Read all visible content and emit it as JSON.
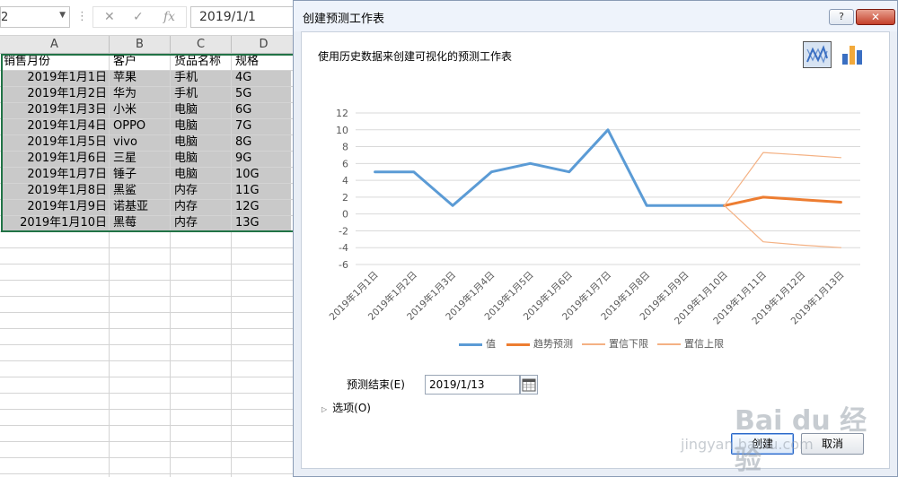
{
  "excel": {
    "namebox": "2",
    "formula_value": "2019/1/1",
    "columns": [
      "A",
      "B",
      "C",
      "D"
    ],
    "headers": [
      "销售月份",
      "客户",
      "货品名称",
      "规格"
    ],
    "rows": [
      [
        "2019年1月1日",
        "苹果",
        "手机",
        "4G"
      ],
      [
        "2019年1月2日",
        "华为",
        "手机",
        "5G"
      ],
      [
        "2019年1月3日",
        "小米",
        "电脑",
        "6G"
      ],
      [
        "2019年1月4日",
        "OPPO",
        "电脑",
        "7G"
      ],
      [
        "2019年1月5日",
        "vivo",
        "电脑",
        "8G"
      ],
      [
        "2019年1月6日",
        "三星",
        "电脑",
        "9G"
      ],
      [
        "2019年1月7日",
        "锤子",
        "电脑",
        "10G"
      ],
      [
        "2019年1月8日",
        "黑鲨",
        "内存",
        "11G"
      ],
      [
        "2019年1月9日",
        "诺基亚",
        "内存",
        "12G"
      ],
      [
        "2019年1月10日",
        "黑莓",
        "内存",
        "13G"
      ]
    ]
  },
  "dialog": {
    "title": "创建预测工作表",
    "help_label": "?",
    "close_label": "✕",
    "subtitle": "使用历史数据来创建可视化的预测工作表",
    "forecast_end_label": "预测结束(E)",
    "forecast_end_value": "2019/1/13",
    "options_label": "选项(O)",
    "create_label": "创建",
    "cancel_label": "取消"
  },
  "chart_data": {
    "type": "line",
    "categories": [
      "2019年1月1日",
      "2019年1月2日",
      "2019年1月3日",
      "2019年1月4日",
      "2019年1月5日",
      "2019年1月6日",
      "2019年1月7日",
      "2019年1月8日",
      "2019年1月9日",
      "2019年1月10日",
      "2019年1月11日",
      "2019年1月12日",
      "2019年1月13日"
    ],
    "yticks": [
      12,
      10,
      8,
      6,
      4,
      2,
      0,
      -2,
      -4,
      -6
    ],
    "ylim": [
      -6,
      12
    ],
    "series": [
      {
        "name": "值",
        "color": "#5b9bd5",
        "width": 3,
        "values": [
          5,
          5,
          1,
          5,
          6,
          5,
          10,
          1,
          1,
          1,
          null,
          null,
          null
        ]
      },
      {
        "name": "趋势预测",
        "color": "#ed7d31",
        "width": 3,
        "values": [
          null,
          null,
          null,
          null,
          null,
          null,
          null,
          null,
          null,
          1,
          2,
          1.7,
          1.4
        ]
      },
      {
        "name": "置信下限",
        "color": "#f4b183",
        "width": 1.2,
        "values": [
          null,
          null,
          null,
          null,
          null,
          null,
          null,
          null,
          null,
          1,
          -3.3,
          -3.7,
          -4.0
        ]
      },
      {
        "name": "置信上限",
        "color": "#f4b183",
        "width": 1.2,
        "values": [
          null,
          null,
          null,
          null,
          null,
          null,
          null,
          null,
          null,
          1,
          7.3,
          7.0,
          6.7
        ]
      }
    ],
    "grid": true,
    "legend": "bottom"
  },
  "watermark": {
    "line1": "Bai du 经验",
    "line2": "jingyan.baidu.com"
  }
}
